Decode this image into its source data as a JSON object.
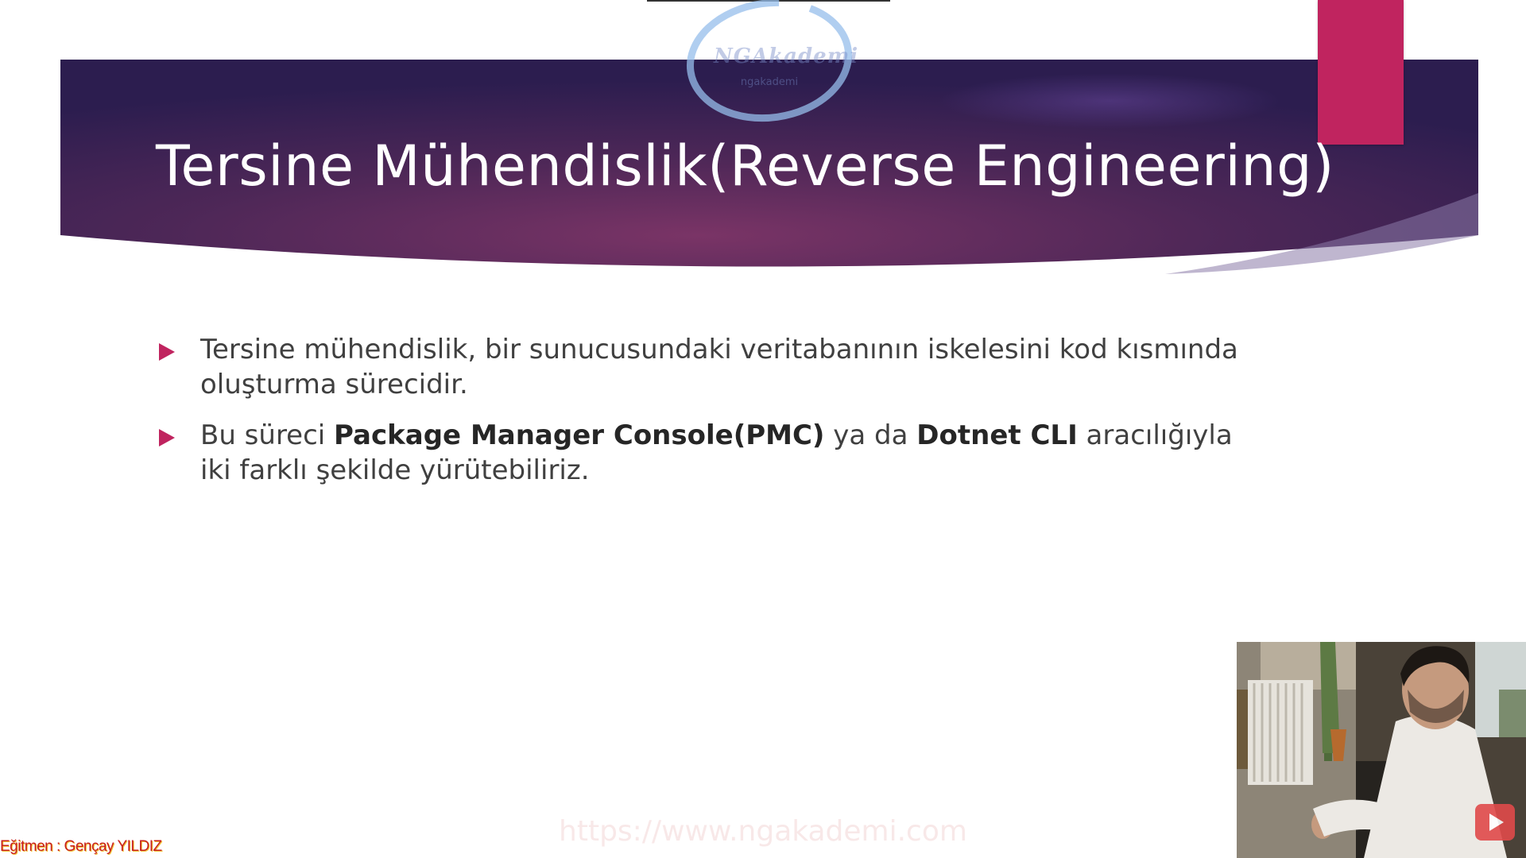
{
  "slide": {
    "title": "Tersine Mühendislik(Reverse Engineering)",
    "bullets": [
      {
        "parts": [
          {
            "text": "Tersine mühendislik, bir sunucusundaki veritabanının iskelesini kod kısmında oluşturma sürecidir.",
            "bold": false
          }
        ]
      },
      {
        "parts": [
          {
            "text": "Bu süreci ",
            "bold": false
          },
          {
            "text": "Package Manager Console(PMC)",
            "bold": true
          },
          {
            "text": " ya da ",
            "bold": false
          },
          {
            "text": "Dotnet CLI",
            "bold": true
          },
          {
            "text": " aracılığıyla iki farklı şekilde yürütebiliriz.",
            "bold": false
          }
        ]
      }
    ]
  },
  "logo": {
    "text": "NGAkademi",
    "subtext": "ngakademi"
  },
  "overlay": {
    "watermark": "https://www.ngakademi.com",
    "instructor": "Eğitmen : Gençay YILDIZ"
  },
  "colors": {
    "accent": "#c0245f",
    "banner_left": "#2c1d4f",
    "banner_center": "#7a3466",
    "banner_right": "#2e2050",
    "body_text": "#404040"
  },
  "icons": {
    "bullet": "triangle-right-icon",
    "play": "play-icon"
  }
}
